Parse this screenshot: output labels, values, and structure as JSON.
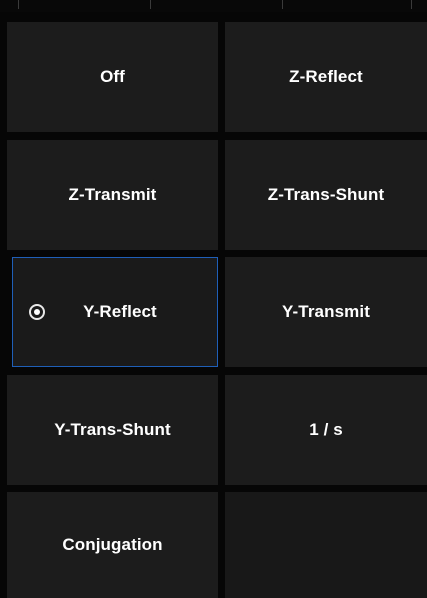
{
  "menu": {
    "buttons": [
      {
        "label": "Off"
      },
      {
        "label": "Z-Reflect"
      },
      {
        "label": "Z-Transmit"
      },
      {
        "label": "Z-Trans-Shunt"
      },
      {
        "label": "Y-Reflect",
        "selected": true
      },
      {
        "label": "Y-Transmit"
      },
      {
        "label": "Y-Trans-Shunt"
      },
      {
        "label": "1 / s"
      },
      {
        "label": "Conjugation"
      }
    ]
  },
  "colors": {
    "background": "#060606",
    "button": "#1c1c1c",
    "selection_border": "#1f5fb8",
    "text": "#ffffff"
  }
}
